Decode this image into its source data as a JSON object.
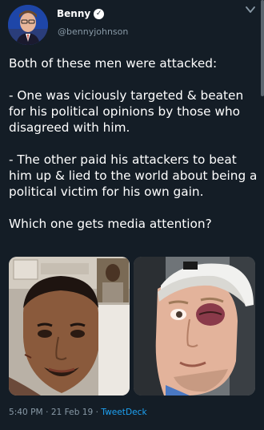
{
  "author": {
    "display_name": "Benny",
    "handle": "@bennyjohnson",
    "verified": true,
    "verified_icon": "verified-badge-icon",
    "avatar_icon": "avatar-photo"
  },
  "menu": {
    "chevron_icon": "chevron-down-icon"
  },
  "tweet": {
    "lines": [
      "Both of these men were attacked:",
      "",
      "- One was viciously targeted & beaten",
      "for his political opinions by those who",
      "disagreed with him.",
      "",
      "- The other paid his attackers to beat",
      "him up & lied to the world about being a",
      "political victim for his own gain.",
      "",
      "Which one gets media attention?"
    ]
  },
  "media": {
    "count": 2,
    "items": [
      {
        "kind": "photo",
        "icon": "photo-man-hospital-selfie"
      },
      {
        "kind": "photo",
        "icon": "photo-man-black-eye-cap"
      }
    ]
  },
  "footer": {
    "time": "5:40 PM",
    "separator": "·",
    "date": "21 Feb 19",
    "source": "TweetDeck"
  },
  "colors": {
    "background": "#141d26",
    "secondary_text": "#8899a6",
    "link": "#1da1f2",
    "text": "#ffffff"
  }
}
